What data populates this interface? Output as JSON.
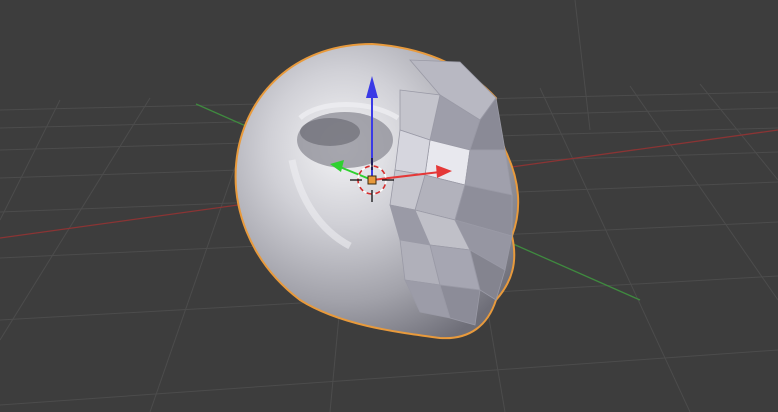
{
  "viewport": {
    "background": "#3d3d3d",
    "grid_color": "#4c4c4c",
    "x_axis_color": "#8a3434",
    "y_axis_color": "#3f8a3f"
  },
  "selected_object": {
    "outline_color": "#e89a3c",
    "surface_base": "#b4b4ba",
    "surface_highlight": "#f2f2f4",
    "surface_shadow": "#6e6e78"
  },
  "transform_gizmo": {
    "x_color": "#e53838",
    "y_color": "#2fd12f",
    "z_color": "#3a3ae6",
    "icons": [
      "translate-x-arrow-icon",
      "translate-y-arrow-icon",
      "translate-z-arrow-icon"
    ]
  },
  "cursor_3d": {
    "icon": "3d-cursor-icon",
    "ring_colors": [
      "#ffffff",
      "#d42e2e"
    ]
  },
  "origin_marker_color": "#e89a3c"
}
